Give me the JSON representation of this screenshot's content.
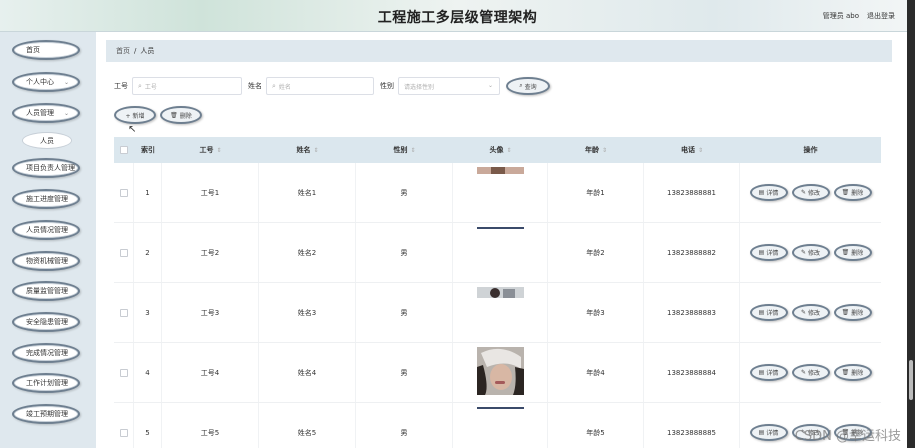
{
  "header": {
    "title": "工程施工多层级管理架构",
    "user": "管理员 abo",
    "logout": "退出登录"
  },
  "sidebar": {
    "items": [
      {
        "label": "首页",
        "expandable": false
      },
      {
        "label": "个人中心",
        "expandable": true
      },
      {
        "label": "人员管理",
        "expandable": true
      },
      {
        "label": "人员",
        "expandable": false,
        "sub": true
      },
      {
        "label": "项目负责人管理",
        "expandable": false
      },
      {
        "label": "施工进度管理",
        "expandable": false
      },
      {
        "label": "人员情况管理",
        "expandable": false
      },
      {
        "label": "物资机械管理",
        "expandable": false
      },
      {
        "label": "质量监管管理",
        "expandable": false
      },
      {
        "label": "安全隐患管理",
        "expandable": false
      },
      {
        "label": "完成情况管理",
        "expandable": false
      },
      {
        "label": "工作计划管理",
        "expandable": false
      },
      {
        "label": "竣工预期管理",
        "expandable": false
      }
    ]
  },
  "breadcrumb": {
    "home": "首页",
    "separator": "/",
    "current": "人员"
  },
  "search": {
    "no_label": "工号",
    "no_placeholder": "工号",
    "name_label": "姓名",
    "name_placeholder": "姓名",
    "sex_label": "性别",
    "sex_placeholder": "请选择性别",
    "query": "查询"
  },
  "actions": {
    "add": "+ 新增",
    "delete": "删除"
  },
  "table": {
    "headers": {
      "index": "索引",
      "no": "工号",
      "name": "姓名",
      "sex": "性别",
      "photo": "头像",
      "age": "年龄",
      "tel": "电话",
      "op": "操作"
    },
    "rows": [
      {
        "index": "1",
        "no": "工号1",
        "name": "姓名1",
        "sex": "男",
        "age": "年龄1",
        "tel": "13823888881",
        "photo": "cropped"
      },
      {
        "index": "2",
        "no": "工号2",
        "name": "姓名2",
        "sex": "男",
        "age": "年龄2",
        "tel": "13823888882",
        "photo": "line"
      },
      {
        "index": "3",
        "no": "工号3",
        "name": "姓名3",
        "sex": "男",
        "age": "年龄3",
        "tel": "13823888883",
        "photo": "dark"
      },
      {
        "index": "4",
        "no": "工号4",
        "name": "姓名4",
        "sex": "男",
        "age": "年龄4",
        "tel": "13823888884",
        "photo": "portrait"
      },
      {
        "index": "5",
        "no": "工号5",
        "name": "姓名5",
        "sex": "男",
        "age": "年龄5",
        "tel": "13823888885",
        "photo": "line"
      }
    ],
    "row_actions": {
      "detail": "详情",
      "edit": "修改",
      "delete": "删除"
    }
  },
  "watermark": "CSDN @幸运科技",
  "colors": {
    "sidebar_bg": "#dfe8ee",
    "table_header_bg": "#dbe7ee",
    "pill_border": "#6e7f90"
  }
}
